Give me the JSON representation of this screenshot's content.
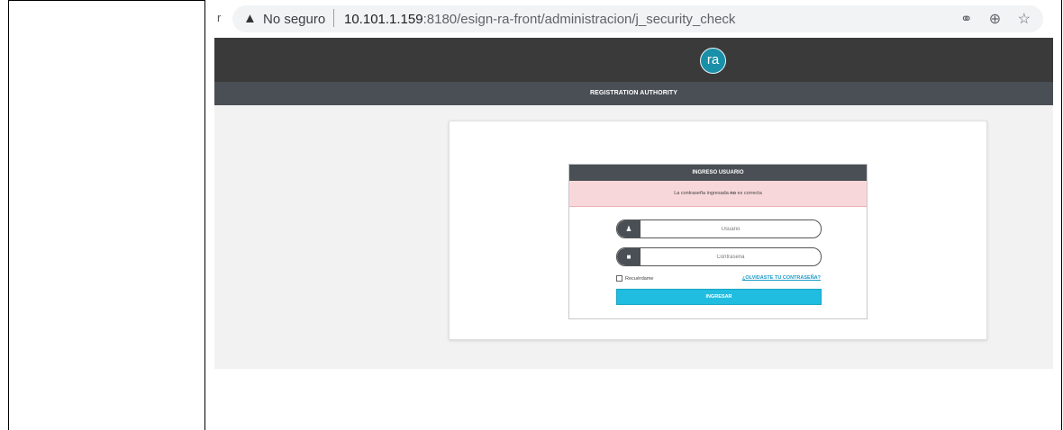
{
  "browser": {
    "back_glyph": "r",
    "warning_icon": "warning-triangle-icon",
    "security_label": "No seguro",
    "url_host": "10.101.1.159",
    "url_rest": ":8180/esign-ra-front/administracion/j_security_check",
    "icons": [
      "key-icon",
      "zoom-icon",
      "star-icon"
    ]
  },
  "app": {
    "logo_text": "ra",
    "header_title": "REGISTRATION AUTHORITY",
    "colors": {
      "topbar": "#3a3a3a",
      "subbar": "#4a4f55",
      "accent": "#20bde0",
      "logo": "#1a8fa8",
      "alert_bg": "#f8d7da"
    }
  },
  "login": {
    "title": "INGRESO USUARIO",
    "alert_prefix": "La contraseña ingresada ",
    "alert_bold": "no",
    "alert_suffix": " es correcta",
    "username_placeholder": "Usuario",
    "password_placeholder": "Contraseña",
    "remember_label": "Recuérdame",
    "forgot_link": "¿OLVIDASTE TU CONTRASEÑA?",
    "submit_label": "INGRESAR"
  }
}
